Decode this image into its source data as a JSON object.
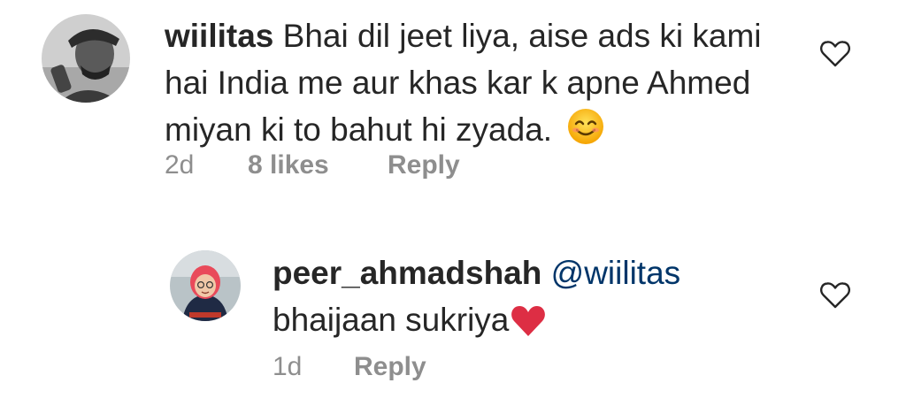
{
  "comments": [
    {
      "username": "wiilitas",
      "text": "Bhai dil jeet liya, aise ads ki kami hai India me aur khas kar k apne Ahmed miyan ki to bahut hi zyada.",
      "emoji": "smiling-face-icon",
      "time": "2d",
      "likes": "8 likes",
      "reply_label": "Reply"
    },
    {
      "username": "peer_ahmadshah",
      "mention": "@wiilitas",
      "text": "bhaijaan sukriya",
      "emoji": "red-heart-icon",
      "time": "1d",
      "reply_label": "Reply"
    }
  ],
  "colors": {
    "text": "#262626",
    "meta": "#8e8e8e",
    "mention": "#003569",
    "heart": "#dd2e44"
  }
}
